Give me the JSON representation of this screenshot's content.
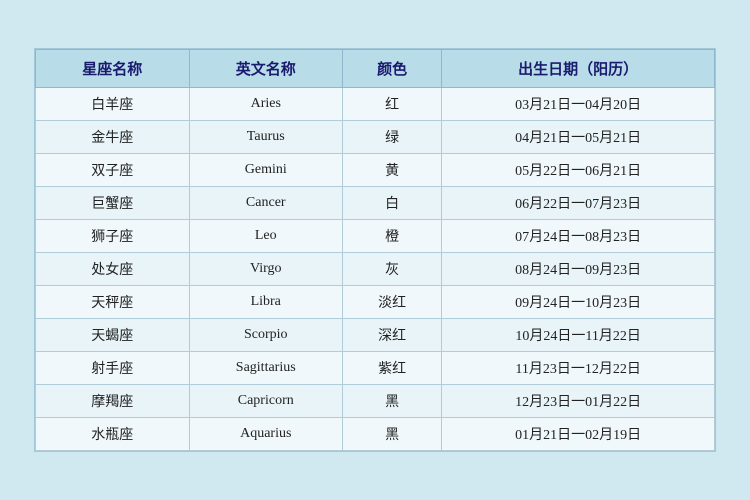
{
  "table": {
    "headers": [
      "星座名称",
      "英文名称",
      "颜色",
      "出生日期（阳历）"
    ],
    "rows": [
      [
        "白羊座",
        "Aries",
        "红",
        "03月21日一04月20日"
      ],
      [
        "金牛座",
        "Taurus",
        "绿",
        "04月21日一05月21日"
      ],
      [
        "双子座",
        "Gemini",
        "黄",
        "05月22日一06月21日"
      ],
      [
        "巨蟹座",
        "Cancer",
        "白",
        "06月22日一07月23日"
      ],
      [
        "狮子座",
        "Leo",
        "橙",
        "07月24日一08月23日"
      ],
      [
        "处女座",
        "Virgo",
        "灰",
        "08月24日一09月23日"
      ],
      [
        "天秤座",
        "Libra",
        "淡红",
        "09月24日一10月23日"
      ],
      [
        "天蝎座",
        "Scorpio",
        "深红",
        "10月24日一11月22日"
      ],
      [
        "射手座",
        "Sagittarius",
        "紫红",
        "11月23日一12月22日"
      ],
      [
        "摩羯座",
        "Capricorn",
        "黑",
        "12月23日一01月22日"
      ],
      [
        "水瓶座",
        "Aquarius",
        "黑",
        "01月21日一02月19日"
      ]
    ]
  }
}
